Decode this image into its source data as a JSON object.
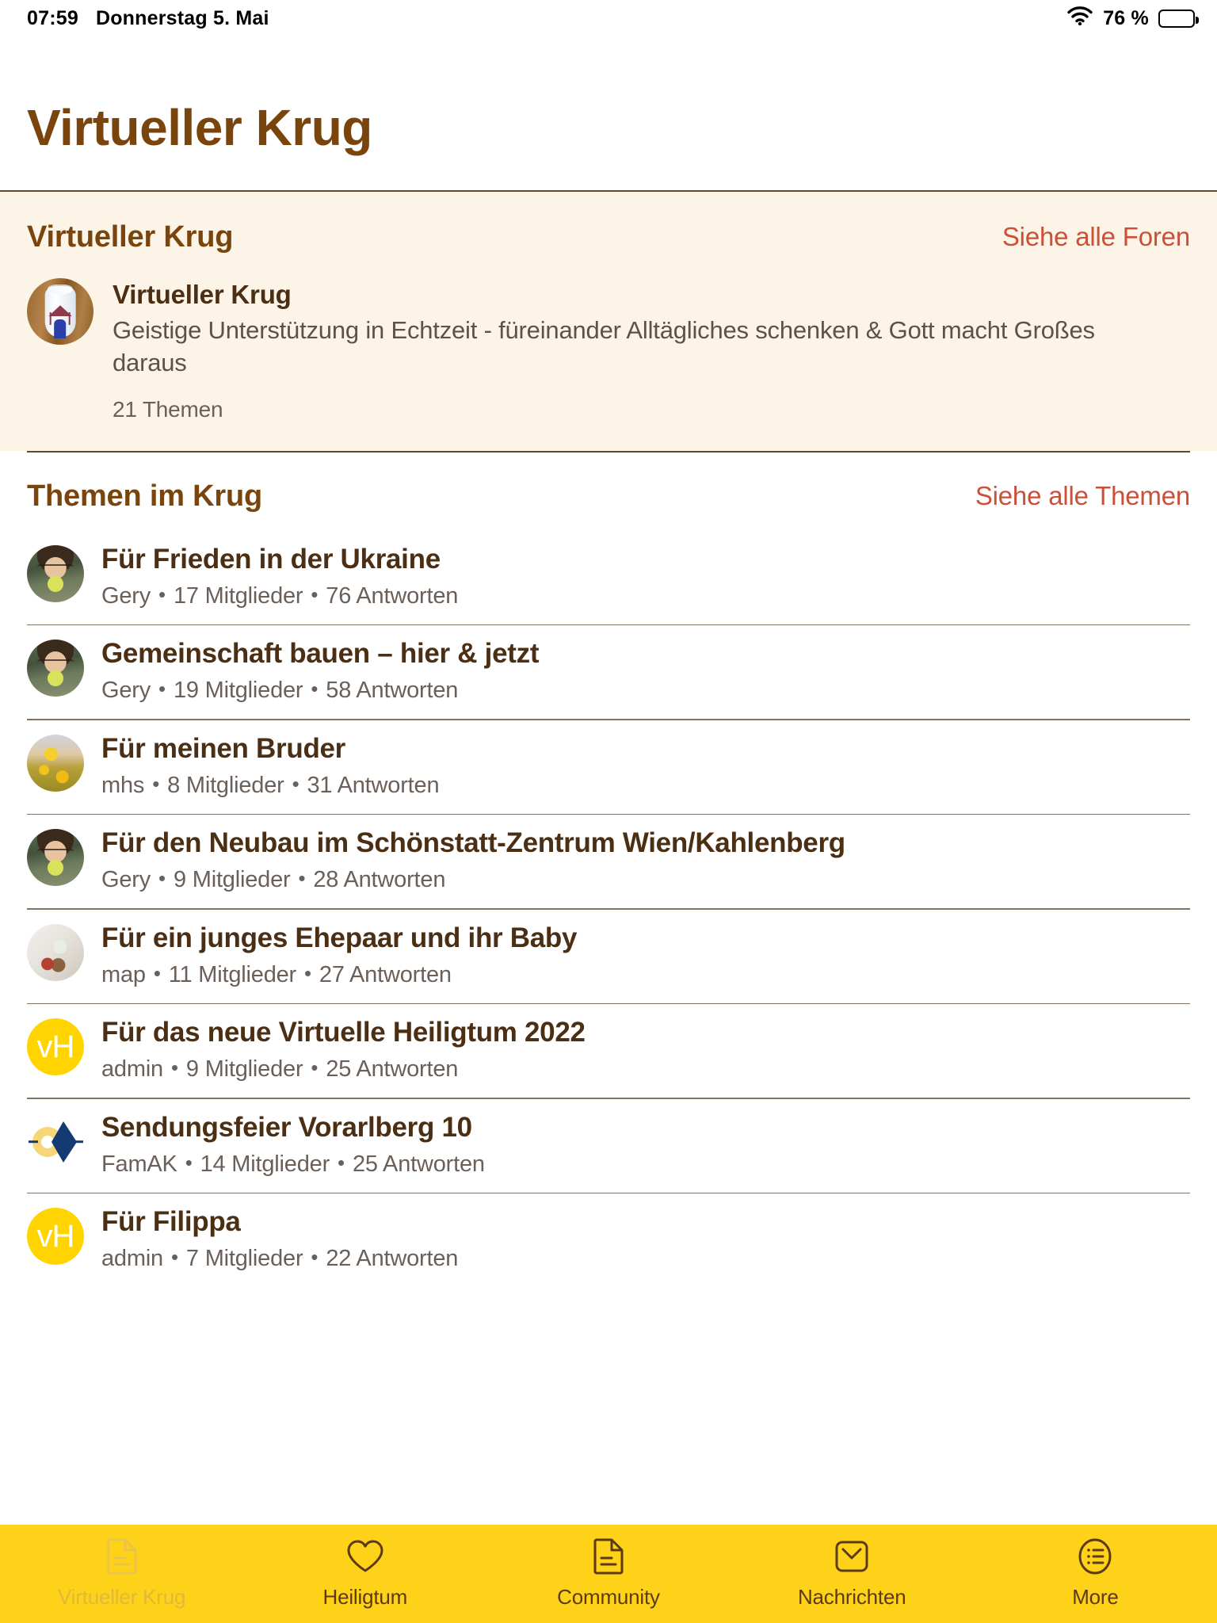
{
  "status_bar": {
    "time": "07:59",
    "date": "Donnerstag 5. Mai",
    "wifi_icon": "wifi-icon",
    "battery_percent": "76 %",
    "battery_icon": "battery-icon"
  },
  "page_title": "Virtueller Krug",
  "forum_section": {
    "title": "Virtueller Krug",
    "link_label": "Siehe alle Foren",
    "forum": {
      "avatar_icon": "jug-avatar",
      "name": "Virtueller Krug",
      "description": "Geistige Unterstützung in Echtzeit - füreinander Alltägliches schenken & Gott macht Großes daraus",
      "topic_count": "21 Themen"
    }
  },
  "topics_section": {
    "title": "Themen im Krug",
    "link_label": "Siehe alle Themen",
    "items": [
      {
        "title": "Für Frieden in der Ukraine",
        "author": "Gery",
        "members": "17 Mitglieder",
        "replies": "76 Antworten",
        "avatar_type": "photo-portrait-forest",
        "avatar_initials": ""
      },
      {
        "title": "Gemeinschaft bauen – hier & jetzt",
        "author": "Gery",
        "members": "19 Mitglieder",
        "replies": "58 Antworten",
        "avatar_type": "photo-portrait-forest",
        "avatar_initials": ""
      },
      {
        "title": "Für meinen Bruder",
        "author": "mhs",
        "members": "8 Mitglieder",
        "replies": "31 Antworten",
        "avatar_type": "photo-sunflower-field",
        "avatar_initials": ""
      },
      {
        "title": "Für den Neubau im Schönstatt-Zentrum Wien/Kahlenberg",
        "author": "Gery",
        "members": "9 Mitglieder",
        "replies": "28 Antworten",
        "avatar_type": "photo-portrait-forest",
        "avatar_initials": ""
      },
      {
        "title": "Für ein junges Ehepaar und ihr Baby",
        "author": "map",
        "members": "11 Mitglieder",
        "replies": "27 Antworten",
        "avatar_type": "photo-home-interior",
        "avatar_initials": ""
      },
      {
        "title": "Für das neue Virtuelle Heiligtum 2022",
        "author": "admin",
        "members": "9 Mitglieder",
        "replies": "25 Antworten",
        "avatar_type": "initials-yellow",
        "avatar_initials": "vH"
      },
      {
        "title": "Sendungsfeier Vorarlberg 10",
        "author": "FamAK",
        "members": "14 Mitglieder",
        "replies": "25 Antworten",
        "avatar_type": "logo-diamond",
        "avatar_initials": ""
      },
      {
        "title": "Für Filippa",
        "author": "admin",
        "members": "7 Mitglieder",
        "replies": "22 Antworten",
        "avatar_type": "initials-yellow",
        "avatar_initials": "vH"
      }
    ],
    "separator": "•"
  },
  "tab_bar": {
    "tabs": [
      {
        "label": "Virtueller Krug",
        "icon": "document-icon",
        "active": true
      },
      {
        "label": "Heiligtum",
        "icon": "heart-icon",
        "active": false
      },
      {
        "label": "Community",
        "icon": "document-icon",
        "active": false
      },
      {
        "label": "Nachrichten",
        "icon": "envelope-icon",
        "active": false
      },
      {
        "label": "More",
        "icon": "list-circle-icon",
        "active": false
      }
    ]
  },
  "colors": {
    "title_brown": "#7a440d",
    "link_red": "#cc4f39",
    "card_cream": "#fdf4e8",
    "tab_yellow": "#ffd21a",
    "avatar_yellow": "#ffd400",
    "text_dark_brown": "#4a2f14",
    "meta_gray": "#6b6059"
  }
}
